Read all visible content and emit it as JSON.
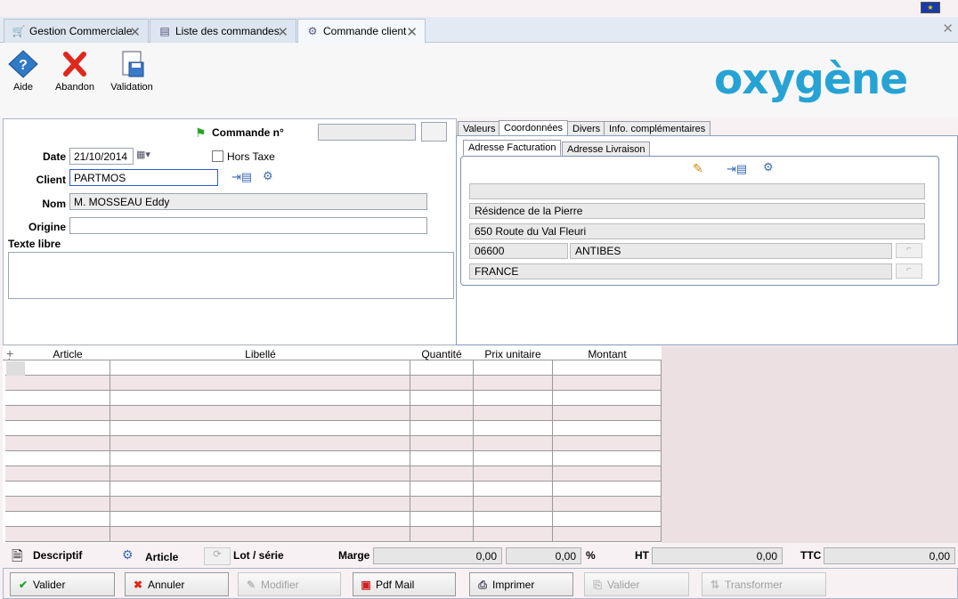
{
  "tabs": [
    {
      "label": "Gestion Commerciale",
      "icon": "cart-icon"
    },
    {
      "label": "Liste des commandes",
      "icon": "list-icon"
    },
    {
      "label": "Commande client",
      "icon": "gear-icon"
    }
  ],
  "toolbar": {
    "help_label": "Aide",
    "abandon_label": "Abandon",
    "validation_label": "Validation"
  },
  "logo_text": "oxygène",
  "form": {
    "commande_label": "Commande n°",
    "date_label": "Date",
    "date_value": "21/10/2014",
    "hors_taxe_label": "Hors Taxe",
    "client_label": "Client",
    "client_value": "PARTMOS",
    "nom_label": "Nom",
    "nom_value": "M. MOSSEAU Eddy",
    "origine_label": "Origine",
    "texte_libre_label": "Texte libre"
  },
  "right_tabs": [
    "Valeurs",
    "Coordonnées",
    "Divers",
    "Info. complémentaires"
  ],
  "address_tabs": [
    "Adresse Facturation",
    "Adresse Livraison"
  ],
  "address": {
    "line1": "",
    "line2": "Résidence de la Pierre",
    "line3": "650 Route du Val Fleuri",
    "postal_code": "06600",
    "city": "ANTIBES",
    "country": "FRANCE"
  },
  "grid": {
    "columns": [
      "Article",
      "Libellé",
      "Quantité",
      "Prix unitaire",
      "Montant"
    ],
    "row_count": 12
  },
  "summary": {
    "descriptif_label": "Descriptif",
    "article_label": "Article",
    "lot_label": "Lot / série",
    "marge_label": "Marge",
    "marge_value": "0,00",
    "marge_pct": "0,00",
    "pct_sign": "%",
    "ht_label": "HT",
    "ht_value": "0,00",
    "ttc_label": "TTC",
    "ttc_value": "0,00"
  },
  "buttons": {
    "valider": "Valider",
    "annuler": "Annuler",
    "modifier": "Modifier",
    "pdf_mail": "Pdf Mail",
    "imprimer": "Imprimer",
    "valider2": "Valider",
    "transformer": "Transformer"
  },
  "colors": {
    "accent": "#26a3d4",
    "cancel_red": "#e0281c",
    "valid_green": "#2aa52a"
  }
}
